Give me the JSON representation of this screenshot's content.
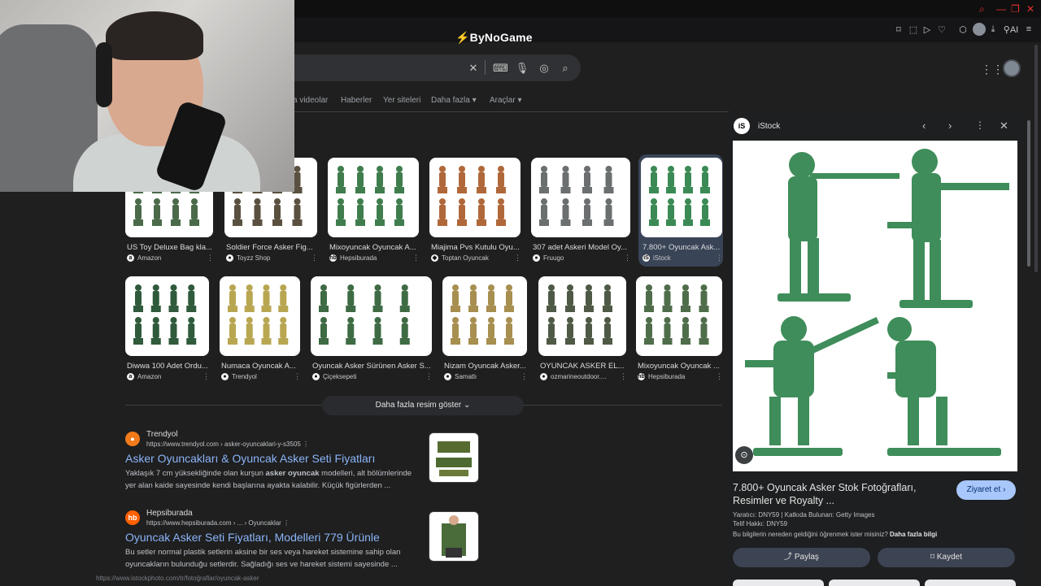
{
  "browser": {
    "logo_text": "ByNoGame",
    "logo_mark": "⚡"
  },
  "search": {
    "tabs": [
      "a videolar",
      "Haberler",
      "Yer siteleri",
      "Daha fazla",
      "Araçlar"
    ]
  },
  "images_row1": [
    {
      "caption": "US Toy Deluxe Bag kla...",
      "source": "Amazon",
      "fav": "a",
      "color": "#4a6a4a"
    },
    {
      "caption": "Soldier Force Asker Fig...",
      "source": "Toyzz Shop",
      "fav": "●",
      "color": "#5a5040"
    },
    {
      "caption": "Mixoyuncak Oyuncak A...",
      "source": "Hepsiburada",
      "fav": "hb",
      "color": "#3f7d4d"
    },
    {
      "caption": "Miajima Pvs Kutulu Oyu...",
      "source": "Toptan Oyuncak",
      "fav": "◆",
      "color": "#b0683a"
    },
    {
      "caption": "307 adet Askeri Model Oy...",
      "source": "Fruugo",
      "fav": "●",
      "color": "#6b6f70"
    },
    {
      "caption": "7.800+ Oyuncak Ask...",
      "source": "iStock",
      "fav": "iS",
      "color": "#3b8a55"
    }
  ],
  "images_row2": [
    {
      "caption": "Diwwa 100 Adet Ordu...",
      "source": "Amazon",
      "fav": "a",
      "color": "#2f5a3c"
    },
    {
      "caption": "Numaca Oyuncak A...",
      "source": "Trendyol",
      "fav": "●",
      "color": "#b9a651"
    },
    {
      "caption": "Oyuncak Asker Sürünen Asker S...",
      "source": "Çiçeksepeti",
      "fav": "●",
      "color": "#3e6b44"
    },
    {
      "caption": "Nizam Oyuncak Asker...",
      "source": "Samatlı",
      "fav": "●",
      "color": "#a78f50"
    },
    {
      "caption": "OYUNCAK ASKER EL...",
      "source": "ozmarineoutdoor....",
      "fav": "●",
      "color": "#4f5a46"
    },
    {
      "caption": "Mixoyuncak Oyuncak ...",
      "source": "Hepsiburada",
      "fav": "hb",
      "color": "#4f6d4a"
    }
  ],
  "more_images": "Daha fazla resim göster",
  "results": [
    {
      "site": "Trendyol",
      "url": "https://www.trendyol.com › asker-oyuncaklari-y-s3505",
      "title": "Asker Oyuncakları & Oyuncak Asker Seti Fiyatları",
      "snippet_a": "Yaklaşık 7 cm yüksekliğinde olan kurşun ",
      "snippet_bold": "asker oyuncak",
      "snippet_b": " modelleri, alt bölümlerinde yer alan kaide sayesinde kendi başlarına ayakta kalabilir. Küçük figürlerden ...",
      "logo_color": "#f27a1a",
      "logo_letter": "●"
    },
    {
      "site": "Hepsiburada",
      "url": "https://www.hepsiburada.com › ... › Oyuncaklar",
      "title": "Oyuncak Asker Seti Fiyatları, Modelleri 779 Ürünle",
      "snippet_a": "Bu setler normal plastik setlerin aksine bir ses veya hareket sistemine sahip olan oyuncakların bulunduğu setlerdir. Sağladığı ses ve hareket sistemi sayesinde ...",
      "snippet_bold": "",
      "snippet_b": "",
      "logo_color": "#ff6000",
      "logo_letter": "hb"
    }
  ],
  "panel": {
    "source": "iStock",
    "title": "7.800+ Oyuncak Asker Stok Fotoğrafları, Resimler ve Royalty ...",
    "visit": "Ziyaret et",
    "creator": "Yaratıcı: DNY59 | Katkıda Bulunan: Getty Images",
    "copyright": "Telif Hakkı: DNY59",
    "learn_a": "Bu bilgilerin nereden geldiğini öğrenmek ister misiniz? ",
    "learn_b": "Daha fazla bilgi",
    "share": "Paylaş",
    "save": "Kaydet"
  },
  "status_url": "https://www.istockphoto.com/tr/fotoğraflar/oyuncak-asker",
  "colors": {
    "accent": "#8ab4f8",
    "toy_green": "#3f8d5a",
    "visit_bg": "#a8c7fa"
  }
}
